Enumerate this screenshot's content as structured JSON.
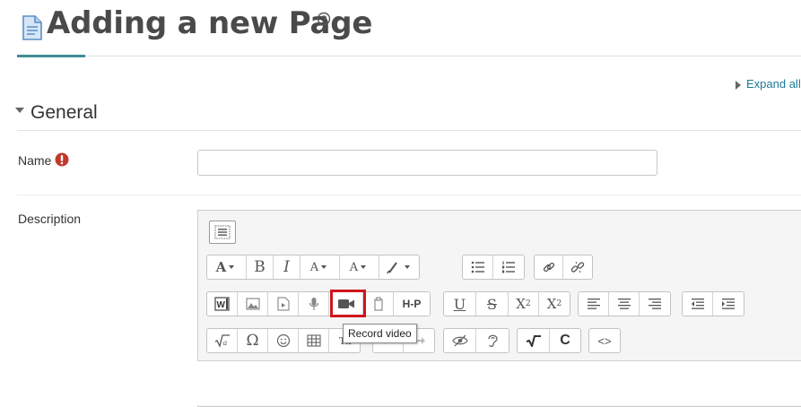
{
  "header": {
    "title": "Adding a new Page",
    "page_icon": "page-icon",
    "help_icon": "help-icon"
  },
  "expand_all": {
    "label": "Expand all"
  },
  "section": {
    "title": "General",
    "name_label": "Name",
    "name_value": "",
    "description_label": "Description"
  },
  "editor": {
    "toolbar_toggle_icon": "toolbar-toggle-icon",
    "row1": [
      "A",
      "B",
      "I",
      "A",
      "A",
      "brush",
      "bullet-list",
      "numbered-list",
      "link",
      "unlink"
    ],
    "row2": [
      "word-import",
      "image",
      "media",
      "record-audio",
      "record-video",
      "paste",
      "H-P",
      "U",
      "S",
      "X2",
      "X2",
      "align-left",
      "align-center",
      "align-right",
      "outdent",
      "indent"
    ],
    "row3": [
      "equation",
      "Ω",
      "emoticon",
      "table",
      "clear-formatting",
      "undo",
      "redo",
      "accessibility-checker",
      "screenreader-helper",
      "math",
      "C",
      "html"
    ],
    "labels": {
      "font": "A",
      "bold": "B",
      "italic": "I",
      "omega": "Ω",
      "hp": "H-P",
      "underline": "U",
      "strike": "S",
      "subscript_base": "X",
      "subscript_num": "2",
      "superscript_base": "X",
      "superscript_num": "2",
      "chem": "C",
      "html": "<>"
    },
    "tooltip": "Record video"
  },
  "colors": {
    "accent": "#3e8d93",
    "link": "#1b7a98",
    "required": "#c0392b",
    "highlight": "#d0151c"
  }
}
